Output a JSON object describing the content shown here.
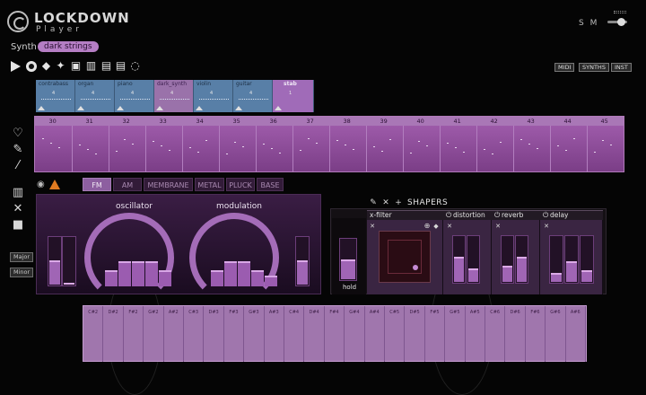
{
  "header": {
    "logo_title": "LOCKDOWN",
    "logo_subtitle": "Player",
    "size_label": "S M"
  },
  "synth": {
    "label": "Synth",
    "preset": "dark strings"
  },
  "toolbar": {
    "icons": [
      "play-icon",
      "record-icon",
      "erase-icon",
      "magic-wand-icon",
      "gift-icon",
      "library-icon",
      "download-icon",
      "export-icon",
      "refresh-icon"
    ],
    "right_buttons": [
      "MIDI",
      "SYNTHS",
      "INST"
    ]
  },
  "instruments": [
    {
      "name": "contrabass",
      "num": "4",
      "color": "blue"
    },
    {
      "name": "organ",
      "num": "4",
      "color": "blue"
    },
    {
      "name": "piano",
      "num": "4",
      "color": "blue"
    },
    {
      "name": "dark_synth",
      "num": "4",
      "color": "purple"
    },
    {
      "name": "violin",
      "num": "4",
      "color": "blue"
    },
    {
      "name": "guitar",
      "num": "4",
      "color": "blue"
    },
    {
      "name": "stab",
      "num": "1",
      "color": "active"
    }
  ],
  "timeline": {
    "measures": [
      "30",
      "31",
      "32",
      "33",
      "34",
      "35",
      "36",
      "37",
      "38",
      "39",
      "40",
      "41",
      "42",
      "43",
      "44",
      "45"
    ]
  },
  "scale_buttons": [
    "Major",
    "Minor"
  ],
  "tabs": [
    {
      "label": "FM",
      "active": true
    },
    {
      "label": "AM",
      "active": false
    },
    {
      "label": "MEMBRANE",
      "active": false
    },
    {
      "label": "METAL",
      "active": false
    },
    {
      "label": "PLUCK",
      "active": false
    },
    {
      "label": "BASE",
      "active": false
    }
  ],
  "panel": {
    "oscillator_label": "oscillator",
    "modulation_label": "modulation",
    "hold_label": "hold",
    "shapers_label": "SHAPERS",
    "fx": [
      {
        "name": "x-filter"
      },
      {
        "name": "distortion"
      },
      {
        "name": "reverb"
      },
      {
        "name": "delay"
      }
    ]
  },
  "levels": {
    "osc_left_fader": 0.52,
    "mod_right_fader": 0.52,
    "hold": 0.5,
    "distortion": [
      0.55,
      0.3
    ],
    "reverb": [
      0.35,
      0.55
    ],
    "delay": [
      0.2,
      0.45,
      0.25
    ]
  },
  "keyboard": {
    "keys": [
      "C#2",
      "D#2",
      "F#2",
      "G#2",
      "A#2",
      "C#3",
      "D#3",
      "F#3",
      "G#3",
      "A#3",
      "C#4",
      "D#4",
      "F#4",
      "G#4",
      "A#4",
      "C#5",
      "D#5",
      "F#5",
      "G#5",
      "A#5",
      "C#6",
      "D#6",
      "F#6",
      "G#6",
      "A#6"
    ]
  },
  "colors": {
    "accent": "#a46cb8",
    "blue": "#587fa7",
    "warning": "#e07a20"
  }
}
